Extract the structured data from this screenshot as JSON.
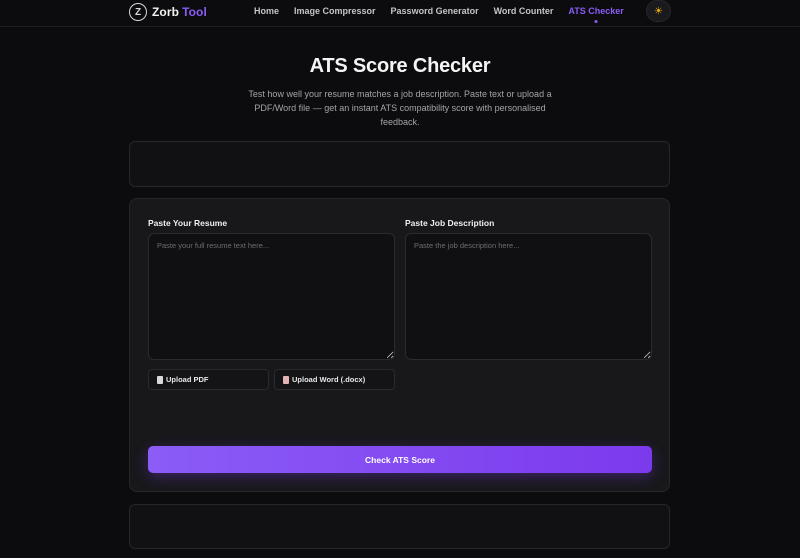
{
  "nav": {
    "logo_mark": "Z",
    "brand_word1": "Zorb",
    "brand_word2": "Tool",
    "links": [
      "Home",
      "Image Compressor",
      "Password Generator",
      "Word Counter",
      "ATS Checker"
    ],
    "active_link": "ATS Checker",
    "theme_icon": "sun-icon",
    "theme_glyph": "☀"
  },
  "header": {
    "title": "ATS Score Checker",
    "subtitle": "Test how well your resume matches a job description. Paste text or upload a PDF/Word file — get an instant ATS compatibility score with personalised feedback."
  },
  "form": {
    "resume_label": "Paste Your Resume",
    "resume_placeholder": "Paste your full resume text here...",
    "resume_value": "",
    "jd_label": "Paste Job Description",
    "jd_placeholder": "Paste the job description here...",
    "jd_value": "",
    "upload_pdf_label": "Upload PDF",
    "upload_word_label": "Upload Word (.docx)",
    "submit_label": "Check ATS Score"
  },
  "colors": {
    "accent": "#8b5cf6",
    "background": "#0c0c0e",
    "card": "#18181b"
  }
}
